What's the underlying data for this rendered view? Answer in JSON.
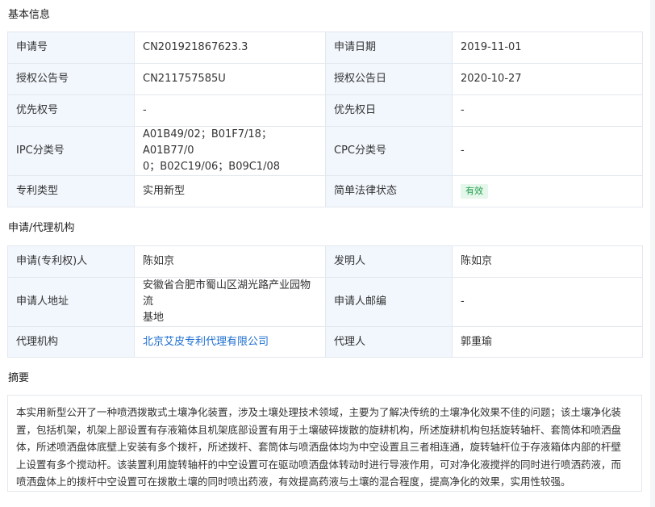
{
  "sections": {
    "basic": "基本信息",
    "applicant": "申请/代理机构",
    "abstract": "摘要"
  },
  "basic": {
    "application_no_label": "申请号",
    "application_no": "CN201921867623.3",
    "application_date_label": "申请日期",
    "application_date": "2019-11-01",
    "grant_pub_no_label": "授权公告号",
    "grant_pub_no": "CN211757585U",
    "grant_pub_date_label": "授权公告日",
    "grant_pub_date": "2020-10-27",
    "priority_no_label": "优先权号",
    "priority_no": "-",
    "priority_date_label": "优先权日",
    "priority_date": "-",
    "ipc_label": "IPC分类号",
    "ipc_line1": "A01B49/02；B01F7/18；A01B77/0",
    "ipc_line2": "0；B02C19/06；B09C1/08",
    "cpc_label": "CPC分类号",
    "cpc": "-",
    "patent_type_label": "专利类型",
    "patent_type": "实用新型",
    "legal_status_label": "简单法律状态",
    "legal_status": "有效"
  },
  "applicant": {
    "applicant_label": "申请(专利权)人",
    "applicant": "陈如京",
    "inventor_label": "发明人",
    "inventor": "陈如京",
    "address_label": "申请人地址",
    "address_line1": "安徽省合肥市蜀山区湖光路产业园物流",
    "address_line2": "基地",
    "postcode_label": "申请人邮编",
    "postcode": "-",
    "agency_label": "代理机构",
    "agency": "北京艾皮专利代理有限公司",
    "agent_label": "代理人",
    "agent": "郭重瑜"
  },
  "abstract": {
    "line1": "本实用新型公开了一种喷洒拨散式土壤净化装置，涉及土壤处理技术领域，主要为了解决传统的土壤净化效果不佳的问题；该土壤净化装",
    "line2": "置，包括机架，机架上部设置有存液箱体且机架底部设置有用于土壤破碎拨散的旋耕机构，所述旋耕机构包括旋转轴杆、套筒体和喷洒盘",
    "line3": "体，所述喷洒盘体底壁上安装有多个拨杆，所述拨杆、套筒体与喷洒盘体均为中空设置且三者相连通，旋转轴杆位于存液箱体内部的杆壁",
    "line4": "上设置有多个搅动杆。该装置利用旋转轴杆的中空设置可在驱动喷洒盘体转动时进行导液作用，可对净化液搅拌的同时进行喷洒药液，而",
    "line5": "喷洒盘体上的拨杆中空设置可在拨散土壤的同时喷出药液，有效提高药液与土壤的混合程度，提高净化的效果，实用性较强。"
  },
  "colors": {
    "label_bg": "#f2f7fd",
    "border": "#e3e8ee",
    "link": "#1e6fd0",
    "badge_bg": "#e5f6ea",
    "badge_text": "#1f9e4c"
  }
}
